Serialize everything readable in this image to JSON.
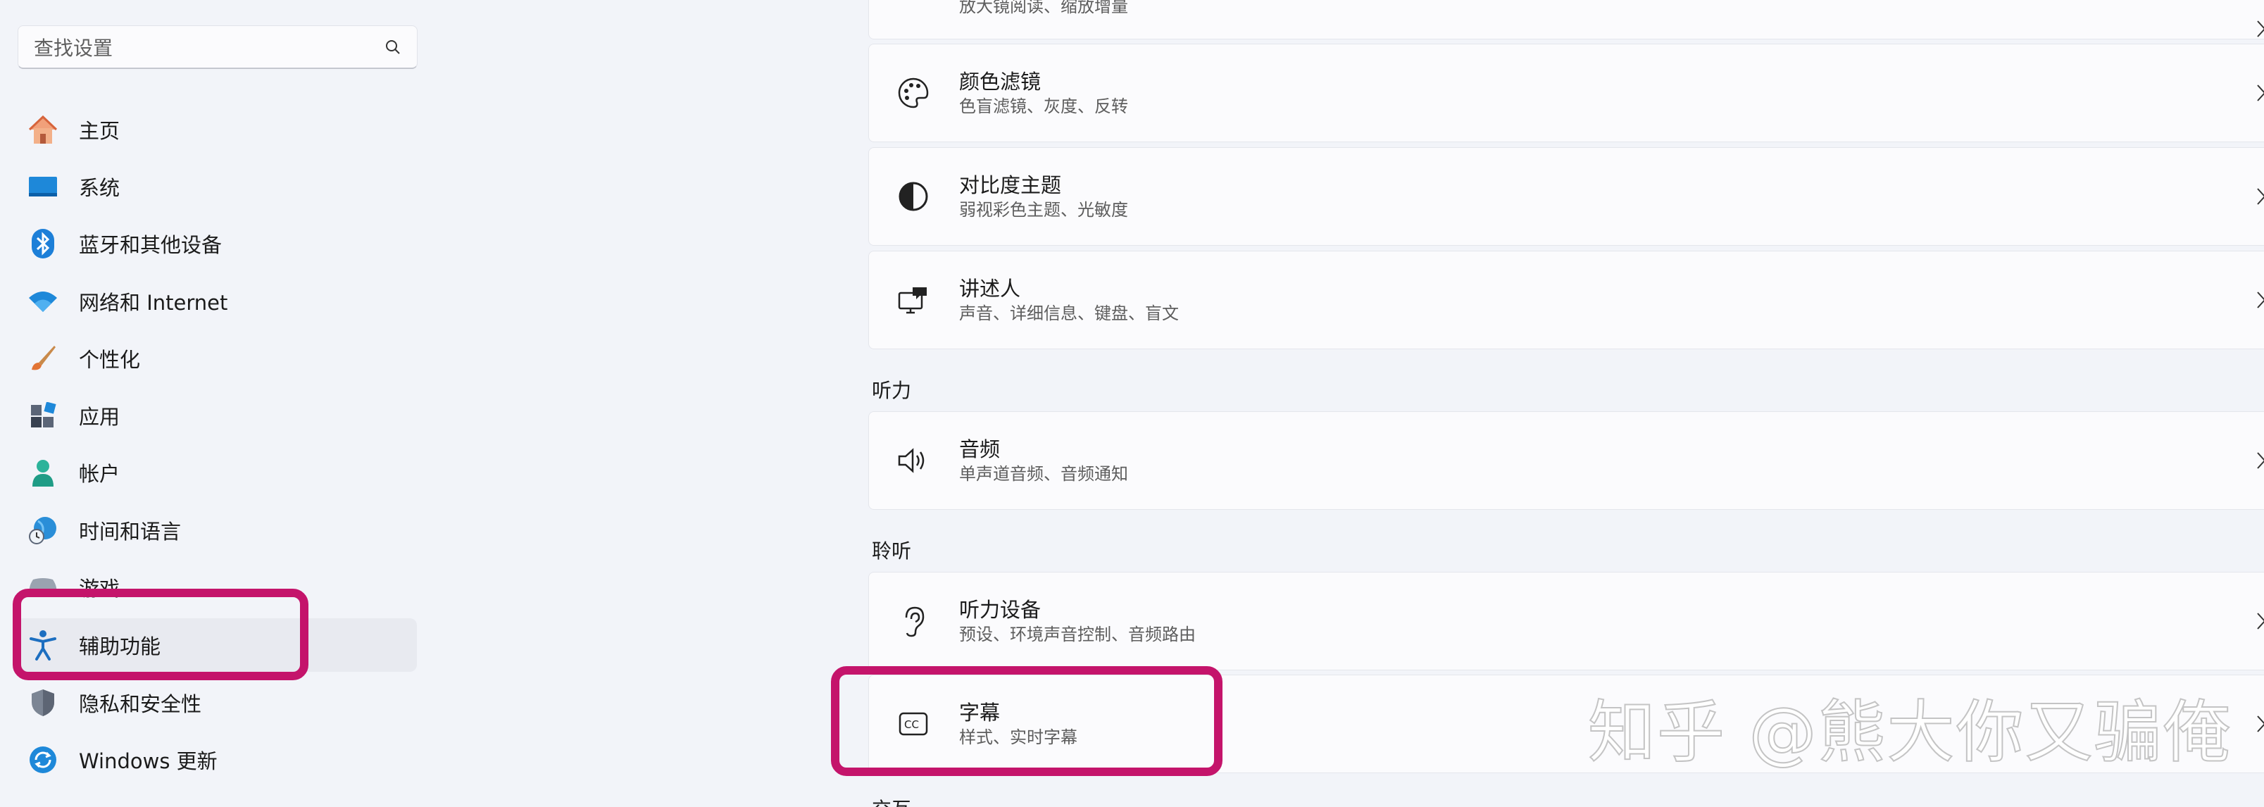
{
  "search": {
    "placeholder": "查找设置"
  },
  "nav": {
    "items": [
      {
        "label": "主页",
        "icon": "home-icon"
      },
      {
        "label": "系统",
        "icon": "monitor-icon"
      },
      {
        "label": "蓝牙和其他设备",
        "icon": "bluetooth-icon"
      },
      {
        "label": "网络和 Internet",
        "icon": "wifi-icon"
      },
      {
        "label": "个性化",
        "icon": "brush-icon"
      },
      {
        "label": "应用",
        "icon": "apps-icon"
      },
      {
        "label": "帐户",
        "icon": "account-icon"
      },
      {
        "label": "时间和语言",
        "icon": "globe-clock-icon"
      },
      {
        "label": "游戏",
        "icon": "gamepad-icon"
      },
      {
        "label": "辅助功能",
        "icon": "accessibility-icon",
        "selected": true
      },
      {
        "label": "隐私和安全性",
        "icon": "shield-icon"
      },
      {
        "label": "Windows 更新",
        "icon": "update-icon"
      }
    ]
  },
  "content": {
    "top_card": {
      "subtitle": "放大镜阅读、缩放增量"
    },
    "color_filter": {
      "title": "颜色滤镜",
      "subtitle": "色盲滤镜、灰度、反转"
    },
    "contrast": {
      "title": "对比度主题",
      "subtitle": "弱视彩色主题、光敏度"
    },
    "narrator": {
      "title": "讲述人",
      "subtitle": "声音、详细信息、键盘、盲文"
    },
    "section_hearing": "听力",
    "audio": {
      "title": "音频",
      "subtitle": "单声道音频、音频通知"
    },
    "section_listening": "聆听",
    "hearing_devices": {
      "title": "听力设备",
      "subtitle": "预设、环境声音控制、音频路由"
    },
    "captions": {
      "title": "字幕",
      "subtitle": "样式、实时字幕"
    },
    "section_bottom": "交互"
  },
  "watermark": "知乎 @熊大你又骗俺",
  "colors": {
    "highlight": "#c4146b",
    "accent": "#0067c0"
  }
}
